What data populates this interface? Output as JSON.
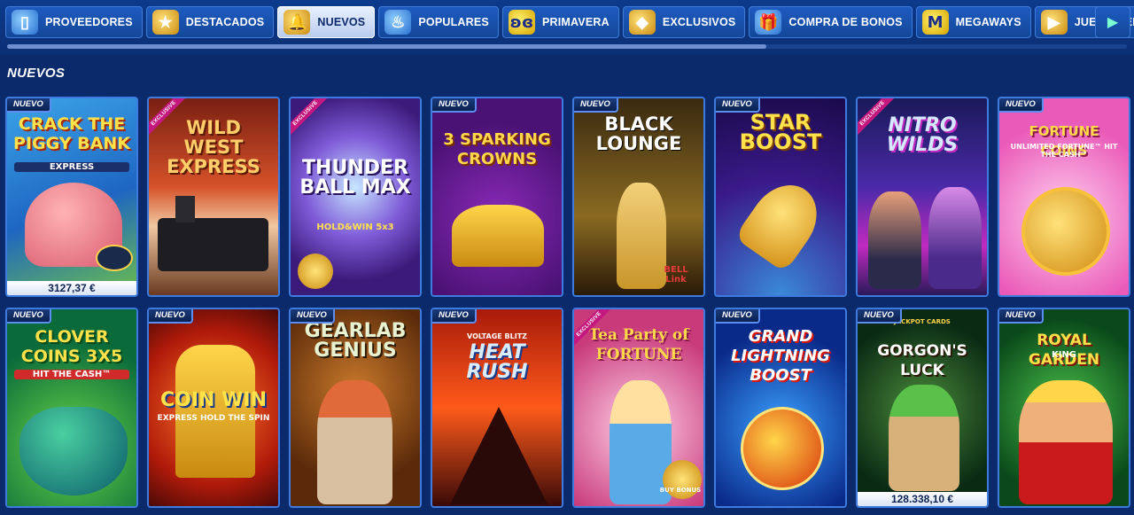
{
  "nav": {
    "items": [
      {
        "label": "PROVEEDORES",
        "icon": "phone-icon",
        "active": false
      },
      {
        "label": "DESTACADOS",
        "icon": "star-icon",
        "active": false
      },
      {
        "label": "NUEVOS",
        "icon": "bell-icon",
        "active": true
      },
      {
        "label": "POPULARES",
        "icon": "torch-icon",
        "active": false
      },
      {
        "label": "PRIMAVERA",
        "icon": "butterfly-icon",
        "active": false
      },
      {
        "label": "EXCLUSIVOS",
        "icon": "gem-icon",
        "active": false
      },
      {
        "label": "COMPRA DE BONOS",
        "icon": "gift-icon",
        "active": false
      },
      {
        "label": "MEGAWAYS",
        "icon": "megaways-m-icon",
        "active": false
      },
      {
        "label": "JUEGOS EN VIVO",
        "icon": "live-play-icon",
        "active": false
      }
    ],
    "next_icon": "chevron-right-icon"
  },
  "section": {
    "title": "NUEVOS"
  },
  "games": [
    {
      "title": "CRACK THE PIGGY BANK",
      "subtitle": "EXPRESS",
      "badge": "NUEVO",
      "jackpot": "3127,37 €"
    },
    {
      "title": "WILD WEST EXPRESS",
      "subtitle": "",
      "ribbon": "EXCLUSIVE"
    },
    {
      "title": "THUNDER BALL MAX",
      "subtitle": "HOLD&WIN 5x3",
      "ribbon": "EXCLUSIVE"
    },
    {
      "title": "3 SPARKING CROWNS",
      "subtitle": "",
      "badge": "NUEVO"
    },
    {
      "title": "BLACK LOUNGE",
      "subtitle": "BELL Link",
      "badge": "NUEVO"
    },
    {
      "title": "STAR BOOST",
      "subtitle": "",
      "badge": "NUEVO"
    },
    {
      "title": "NITRO WILDS",
      "subtitle": "",
      "ribbon": "EXCLUSIVE"
    },
    {
      "title": "FORTUNE COINS",
      "subtitle": "UNLIMITED FORTUNE™ HIT THE CASH™",
      "badge": "NUEVO"
    },
    {
      "title": "CLOVER COINS 3x5",
      "subtitle": "HIT THE CASH™",
      "badge": "NUEVO"
    },
    {
      "title": "COIN WIN",
      "subtitle": "EXPRESS HOLD THE SPIN",
      "badge": "NUEVO"
    },
    {
      "title": "GEARLAB GENIUS",
      "subtitle": "",
      "badge": "NUEVO"
    },
    {
      "title": "HEAT RUSH",
      "subtitle": "VOLTAGE BLITZ",
      "badge": "NUEVO"
    },
    {
      "title": "Tea Party of FORTUNE",
      "subtitle": "BUY BONUS",
      "ribbon": "EXCLUSIVE"
    },
    {
      "title": "GRAND LIGHTNING BOOST",
      "subtitle": "",
      "badge": "NUEVO"
    },
    {
      "title": "GORGON'S LUCK",
      "subtitle": "JACKPOT CARDS",
      "badge": "NUEVO",
      "jackpot": "128.338,10 €"
    },
    {
      "title": "ROYAL GARDEN",
      "subtitle": "KING",
      "badge": "NUEVO"
    }
  ]
}
